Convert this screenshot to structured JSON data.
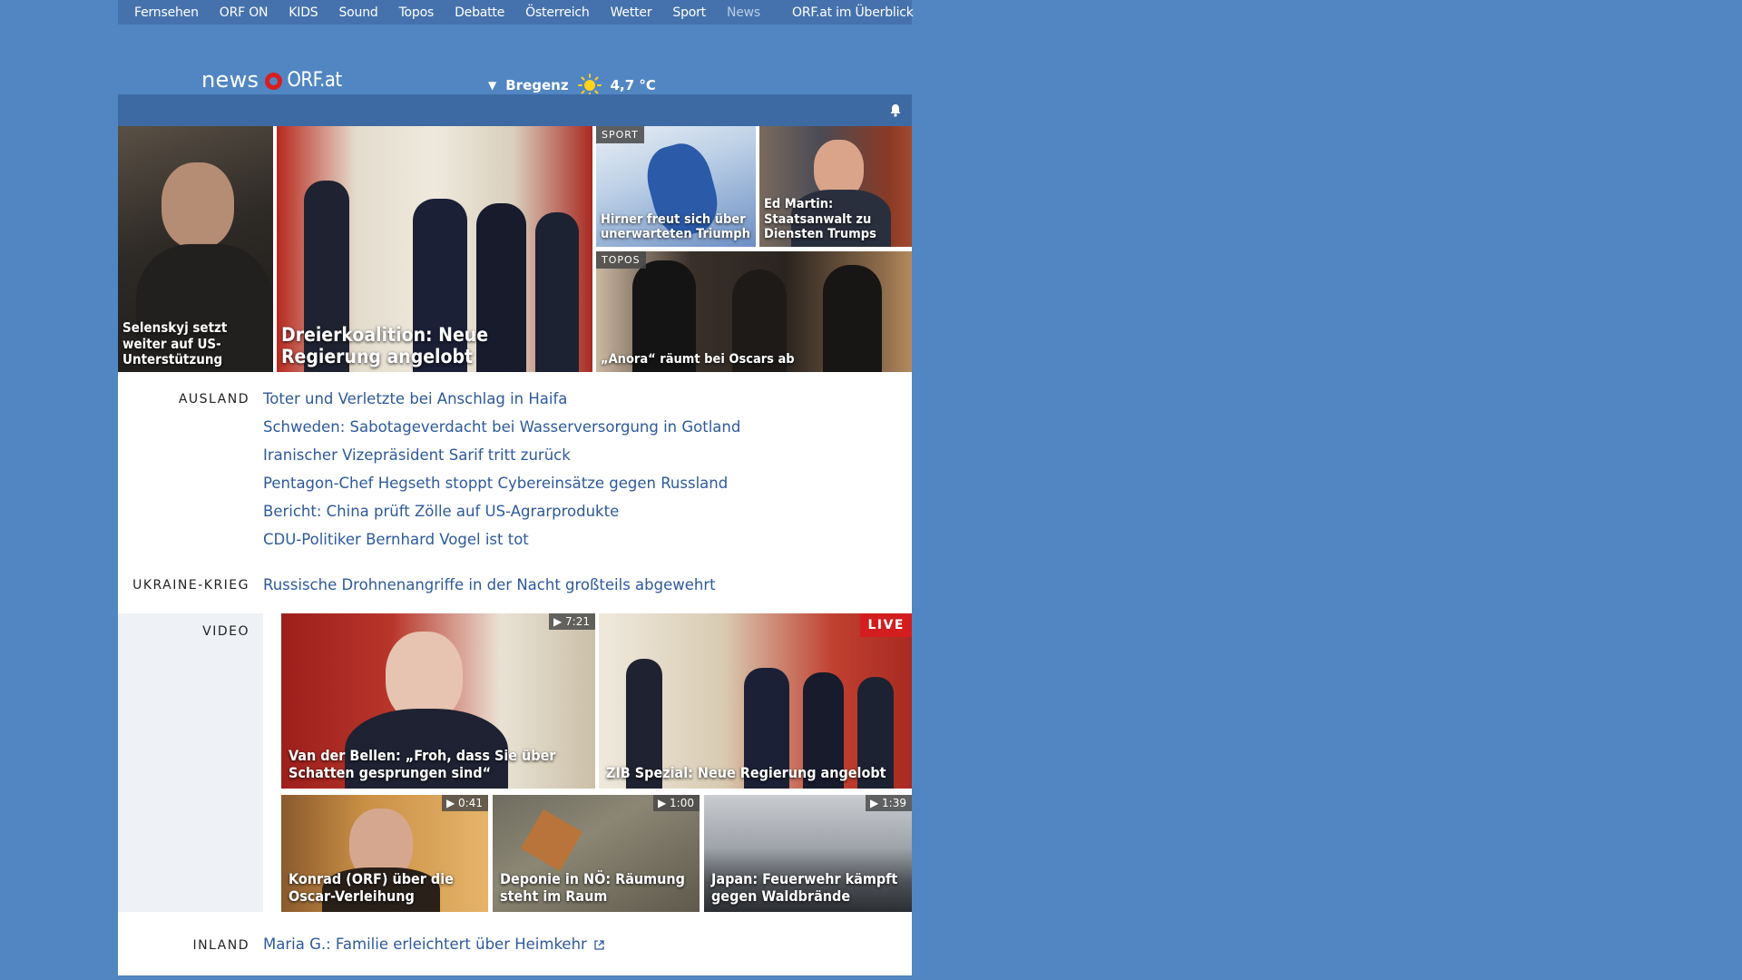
{
  "topnav": {
    "items": [
      "Fernsehen",
      "ORF ON",
      "KIDS",
      "Sound",
      "Topos",
      "Debatte",
      "Österreich",
      "Wetter",
      "Sport",
      "News"
    ],
    "overview": "ORF.at im Überblick"
  },
  "header": {
    "logo_news": "news",
    "logo_orf": "ORF.at",
    "weather_city": "Bregenz",
    "weather_temp": "4,7 °C",
    "weather_icon": "sun-icon"
  },
  "hero": {
    "tiles": [
      {
        "caption": "Selenskyj setzt weiter auf US-Unterstützung"
      },
      {
        "caption": "Dreierkoalition: Neue Regierung angelobt"
      },
      {
        "tag": "SPORT",
        "caption": "Hirner freut sich über unerwarteten Triumph"
      },
      {
        "caption": "Ed Martin: Staatsanwalt zu Diensten Trumps"
      },
      {
        "tag": "TOPOS",
        "caption": "„Anora“ räumt bei Oscars ab"
      }
    ]
  },
  "sections": {
    "ausland": {
      "label": "AUSLAND",
      "links": [
        "Toter und Verletzte bei Anschlag in Haifa",
        "Schweden: Sabotageverdacht bei Wasserversorgung in Gotland",
        "Iranischer Vizepräsident Sarif tritt zurück",
        "Pentagon-Chef Hegseth stoppt Cybereinsätze gegen Russland",
        "Bericht: China prüft Zölle auf US-Agrarprodukte",
        "CDU-Politiker Bernhard Vogel ist tot"
      ]
    },
    "ukraine": {
      "label": "UKRAINE-KRIEG",
      "links": [
        "Russische Drohnenangriffe in der Nacht großteils abgewehrt"
      ]
    },
    "video": {
      "label": "VIDEO",
      "tiles": [
        {
          "caption": "Van der Bellen: „Froh, dass Sie über Schatten gesprungen sind“",
          "duration": "7:21"
        },
        {
          "caption": "ZIB Spezial: Neue Regierung angelobt",
          "live": "LIVE"
        },
        {
          "caption": "Konrad (ORF) über die Oscar-Verleihung",
          "duration": "0:41"
        },
        {
          "caption": "Deponie in NÖ: Räumung steht im Raum",
          "duration": "1:00"
        },
        {
          "caption": "Japan: Feuerwehr kämpft gegen Waldbrände",
          "duration": "1:39"
        }
      ]
    },
    "inland": {
      "label": "INLAND",
      "links": [
        "Maria G.: Familie erleichtert über Heimkehr"
      ]
    }
  },
  "colors": {
    "background": "#5186c2",
    "nav": "#4572ad",
    "bar": "#3e6aa3",
    "link": "#2d5a9b",
    "live": "#d21e1e",
    "logo_ring": "#d81e1e"
  }
}
